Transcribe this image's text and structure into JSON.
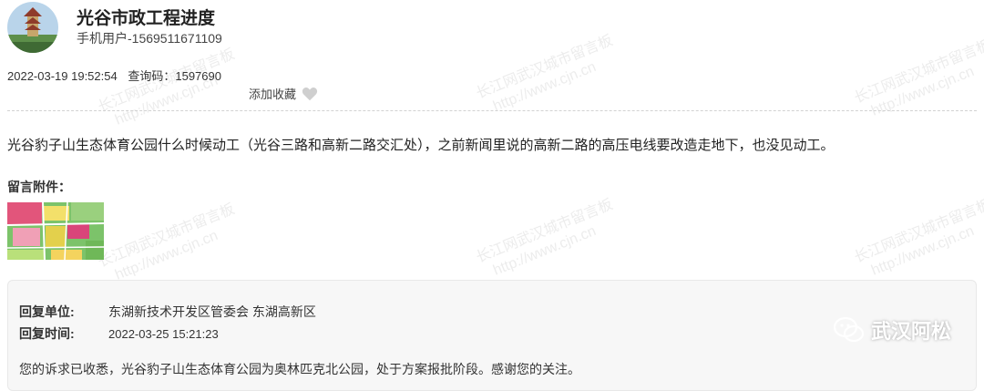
{
  "header": {
    "title": "光谷市政工程进度",
    "user": "手机用户-1569511671109"
  },
  "meta": {
    "datetime": "2022-03-19 19:52:54",
    "code_label": "查询码：",
    "code_value": "1597690",
    "fav_label": "添加收藏",
    "fav_icon": "heart-icon"
  },
  "message": {
    "content": "光谷豹子山生态体育公园什么时候动工（光谷三路和高新二路交汇处），之前新闻里说的高新二路的高压电线要改造走地下，也没见动工。",
    "attachments_label": "留言附件："
  },
  "reply": {
    "unit_label": "回复单位:",
    "unit_value": "东湖新技术开发区管委会 东湖高新区",
    "time_label": "回复时间:",
    "time_value": "2022-03-25 15:21:23",
    "text": "您的诉求已收悉，光谷豹子山生态体育公园为奥林匹克北公园，处于方案报批阶段。感谢您的关注。"
  },
  "watermark": {
    "line1": "长江网武汉城市留言板",
    "line2": "http://www.cjn.cn"
  },
  "brand": {
    "name": "武汉阿松",
    "icon": "wechat-icon"
  }
}
